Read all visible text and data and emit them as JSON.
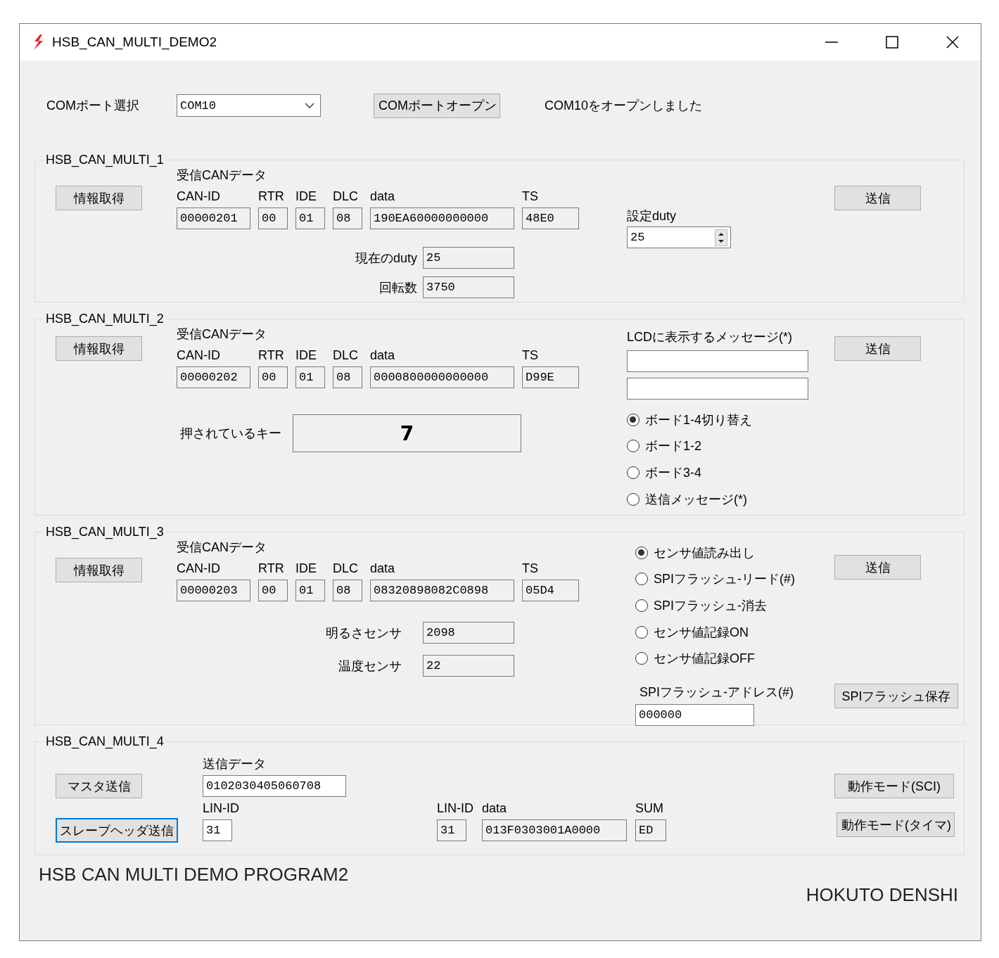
{
  "window": {
    "title": "HSB_CAN_MULTI_DEMO2"
  },
  "com": {
    "label": "COMポート選択",
    "port": "COM10",
    "open_button": "COMポートオープン",
    "status": "COM10をオープンしました"
  },
  "multi_1": {
    "title": "HSB_CAN_MULTI_1",
    "info_button": "情報取得",
    "can": {
      "caption": "受信CANデータ",
      "fields": [
        {
          "label": "CAN-ID",
          "value": "00000201"
        },
        {
          "label": "RTR",
          "value": "00"
        },
        {
          "label": "IDE",
          "value": "01"
        },
        {
          "label": "DLC",
          "value": "08"
        },
        {
          "label": "data",
          "value": "190EA60000000000"
        },
        {
          "label": "TS",
          "value": "48E0"
        }
      ]
    },
    "readings": [
      {
        "label": "現在のduty",
        "value": "25"
      },
      {
        "label": "回転数",
        "value": "3750"
      }
    ],
    "duty": {
      "label": "設定duty",
      "value": "25"
    },
    "send_button": "送信"
  },
  "multi_2": {
    "title": "HSB_CAN_MULTI_2",
    "info_button": "情報取得",
    "can": {
      "caption": "受信CANデータ",
      "fields": [
        {
          "label": "CAN-ID",
          "value": "00000202"
        },
        {
          "label": "RTR",
          "value": "00"
        },
        {
          "label": "IDE",
          "value": "01"
        },
        {
          "label": "DLC",
          "value": "08"
        },
        {
          "label": "data",
          "value": "0000800000000000"
        },
        {
          "label": "TS",
          "value": "D99E"
        }
      ]
    },
    "key": {
      "label": "押されているキー",
      "value": "7"
    },
    "lcd": {
      "label": "LCDに表示するメッセージ(*)"
    },
    "modes": [
      {
        "label": "ボード1-4切り替え",
        "selected": true
      },
      {
        "label": "ボード1-2",
        "selected": false
      },
      {
        "label": "ボード3-4",
        "selected": false
      },
      {
        "label": "送信メッセージ(*)",
        "selected": false
      }
    ],
    "send_button": "送信"
  },
  "multi_3": {
    "title": "HSB_CAN_MULTI_3",
    "info_button": "情報取得",
    "can": {
      "caption": "受信CANデータ",
      "fields": [
        {
          "label": "CAN-ID",
          "value": "00000203"
        },
        {
          "label": "RTR",
          "value": "00"
        },
        {
          "label": "IDE",
          "value": "01"
        },
        {
          "label": "DLC",
          "value": "08"
        },
        {
          "label": "data",
          "value": "08320898082C0898"
        },
        {
          "label": "TS",
          "value": "05D4"
        }
      ]
    },
    "readings": [
      {
        "label": "明るさセンサ",
        "value": "2098"
      },
      {
        "label": "温度センサ",
        "value": "22"
      }
    ],
    "modes": [
      {
        "label": "センサ値読み出し",
        "selected": true
      },
      {
        "label": "SPIフラッシュ-リード(#)",
        "selected": false
      },
      {
        "label": "SPIフラッシュ-消去",
        "selected": false
      },
      {
        "label": "センサ値記録ON",
        "selected": false
      },
      {
        "label": "センサ値記録OFF",
        "selected": false
      }
    ],
    "send_button": "送信",
    "flash_address": {
      "label": "SPIフラッシュ-アドレス(#)",
      "value": "000000"
    },
    "save_button": "SPIフラッシュ保存"
  },
  "multi_4": {
    "title": "HSB_CAN_MULTI_4",
    "master_button": {
      "label": "マスタ送信",
      "focused": false
    },
    "send_data": {
      "label": "送信データ",
      "value": "0102030405060708"
    },
    "slave_button": {
      "label": "スレーブヘッダ送信",
      "focused": true
    },
    "lin_id": {
      "label": "LIN-ID",
      "value": "31"
    },
    "response": [
      {
        "label": "LIN-ID",
        "value": "31"
      },
      {
        "label": "data",
        "value": "013F0303001A0000"
      },
      {
        "label": "SUM",
        "value": "ED"
      }
    ],
    "mode_buttons": [
      "動作モード(SCI)",
      "動作モード(タイマ)"
    ]
  },
  "footer": {
    "program": "HSB CAN MULTI DEMO PROGRAM2",
    "company": "HOKUTO DENSHI"
  }
}
